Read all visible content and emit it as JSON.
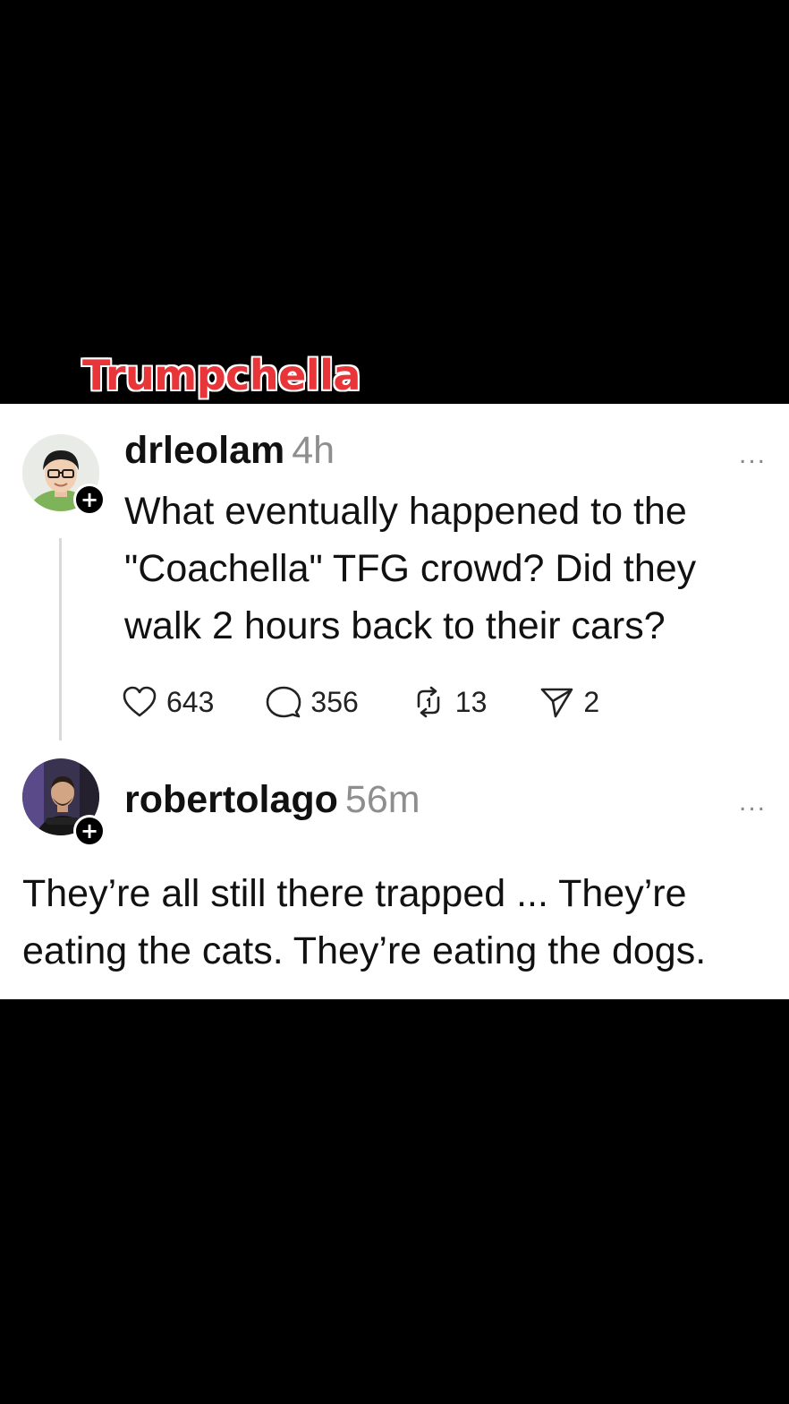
{
  "overlay_title": "Trumpchella",
  "post": {
    "username": "drleolam",
    "time": "4h",
    "text": "What eventually happened to the \"Coachella\" TFG crowd? Did they walk 2 hours back to their cars?",
    "more": "...",
    "likes": "643",
    "replies": "356",
    "reposts": "13",
    "shares": "2"
  },
  "reply": {
    "username": "robertolago",
    "time": "56m",
    "more": "...",
    "text": "They’re all still there trapped ... They’re eating the cats. They’re eating the dogs."
  },
  "icons": {
    "like": "heart-icon",
    "reply": "comment-bubble-icon",
    "repost": "repost-arrows-icon",
    "share": "send-paper-plane-icon",
    "follow": "plus-icon",
    "more": "more-dots-icon"
  },
  "colors": {
    "overlay_title": "#e8353a",
    "timestamp": "#8e8e8e",
    "background": "#000000",
    "card": "#ffffff"
  }
}
